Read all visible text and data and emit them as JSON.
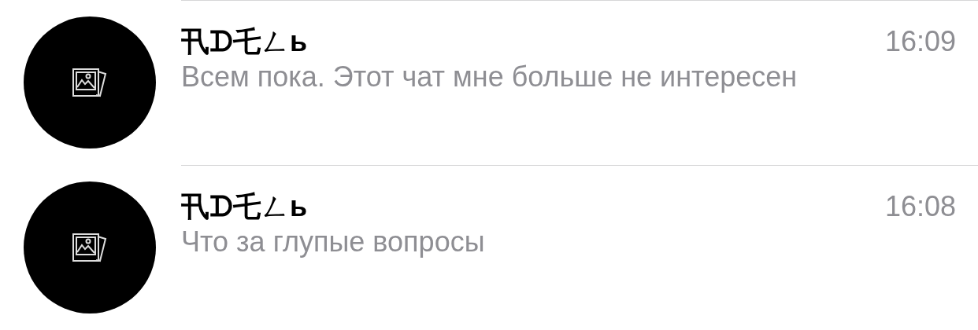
{
  "chats": [
    {
      "name": "卂ᗪ乇ㄥь",
      "time": "16:09",
      "message": "Всем пока. Этот чат мне больше не интересен"
    },
    {
      "name": "卂ᗪ乇ㄥь",
      "time": "16:08",
      "message": "Что за глупые вопросы"
    }
  ]
}
